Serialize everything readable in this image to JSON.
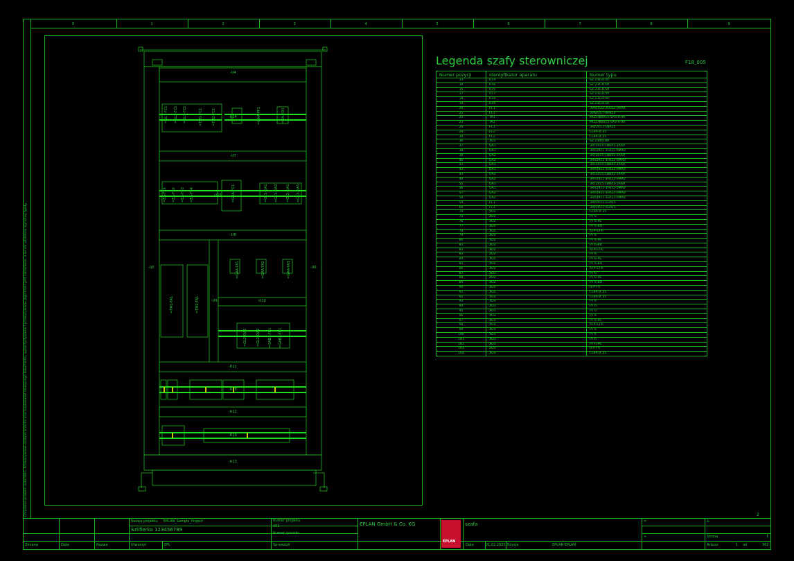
{
  "columns": [
    "0",
    "1",
    "2",
    "3",
    "4",
    "5",
    "6",
    "7",
    "8",
    "9"
  ],
  "side_note": "Chronione prawem autorskim. Przekazywanie osobom trzecim oraz kopiowanie niniejszego dokumentu, wykorzystywanie i przekazywanie jego treści jest zabronione, o ile nie udzielono wyraźnej zgody.",
  "cabinet": {
    "rails": [
      "-U4",
      "-U7",
      "-U8",
      "-U10",
      "-U11",
      "-U12",
      "-U13",
      "-U5",
      "-U6",
      "-U9",
      "-U14",
      "-U15",
      "-U18",
      "-U19"
    ],
    "u14_devices": [
      "=GL1-FC1",
      "=GL2-FC1",
      "=GL3-FC1",
      "=TM1-FC1",
      "=TM2-FC1",
      "=GAA-PF1",
      "=EA-XD1"
    ],
    "u15_devices": [
      "=EA-FB1",
      "=EA-FB2",
      "=EA-FB3",
      "=EA-FB4",
      "=GAA-FC1",
      "=GL1-QA1",
      "=GL1-QA2",
      "=GL2-QA1",
      "=GL3-QA1"
    ],
    "transformers": [
      "=TM1-TA1",
      "=TM2-TA1"
    ],
    "ta_devices": [
      "=GAA-TA1",
      "=GAA-TA2",
      "=GAA-TA3"
    ],
    "u10_devices": [
      "=GL2-QA1",
      "=GL2-QA2",
      "=GAB1-FC1",
      "=GAB2-FC1"
    ]
  },
  "legend": {
    "title": "Legenda szafy sterowniczej",
    "code": "F18_005",
    "headers": [
      "Numer pozycji",
      "Identyfikator aparatu",
      "Numer typu"
    ],
    "rows": [
      [
        "13",
        "U14",
        "SZ.2313150"
      ],
      [
        "14",
        "U16",
        "SZ.2313150"
      ],
      [
        "15",
        "U15",
        "SZ.2313150"
      ],
      [
        "17",
        "U17",
        "SZ.2313150"
      ],
      [
        "18",
        "U18",
        "SZ.2313150"
      ],
      [
        "19",
        "U19",
        "SZ.2313150"
      ],
      [
        "20",
        "FC1",
        "3VA1032-2ED32-0AA0"
      ],
      [
        "21",
        "FC1",
        "3VA9157-0HK25"
      ],
      [
        "22",
        "TA1",
        "MCD780015-SA3-4-00"
      ],
      [
        "23",
        "TA1",
        "MCD780015-SA3-4-00"
      ],
      [
        "24",
        "FC1",
        "3RV2011-1BA25"
      ],
      [
        "29",
        "FC2",
        "CLIPFIX 35"
      ],
      [
        "34",
        "FC2",
        "CLIPFIX 35"
      ],
      [
        "36",
        "XD1",
        "SZ.2306100"
      ],
      [
        "37",
        "QA1",
        "3RT2015-1BB41-1AA0"
      ],
      [
        "38",
        "QA1",
        "3RH2911-1FA22-0MA0"
      ],
      [
        "39",
        "QA2",
        "3RT2015-1BB41-1AA0"
      ],
      [
        "40",
        "QA2",
        "3RH2911-1FA22-0MA0"
      ],
      [
        "41",
        "QA1",
        "3RT2015-1BB41-1AA0"
      ],
      [
        "42",
        "QA1",
        "3RH2911-1FA22-0MA0"
      ],
      [
        "43",
        "QA2",
        "3RT2015-1BB41-1AA0"
      ],
      [
        "44",
        "QA2",
        "3RH2911-1FA22-0MA0"
      ],
      [
        "55",
        "QA1",
        "3RT2015-1BB41-1AA0"
      ],
      [
        "56",
        "QA1",
        "3RH2911-1FA22-0MA0"
      ],
      [
        "57",
        "QA2",
        "3RH2911-1FA22-0MA0"
      ],
      [
        "58",
        "QA2",
        "3RH2911-1FA22-0MA0"
      ],
      [
        "59",
        "FC1",
        "3RV2011-1GA15"
      ],
      [
        "60",
        "FC1",
        "3RV2011-1GA15"
      ],
      [
        "74",
        "XD2",
        "CLIPFIX 35"
      ],
      [
        "75",
        "XD2",
        "PT 6"
      ],
      [
        "76",
        "XD2",
        "PT 6-PE"
      ],
      [
        "77",
        "XD2",
        "PT 6-BU"
      ],
      [
        "78",
        "XD2",
        "ATP-ST-6"
      ],
      [
        "79",
        "XD2",
        "PT 6"
      ],
      [
        "80",
        "XD2",
        "PT 6-PE"
      ],
      [
        "81",
        "XD2",
        "PT 6-BU"
      ],
      [
        "82",
        "XD2",
        "ATP-ST-6"
      ],
      [
        "83",
        "XD2",
        "PT 6"
      ],
      [
        "84",
        "XD2",
        "PT 6-PE"
      ],
      [
        "85",
        "XD2",
        "PT 6-BU"
      ],
      [
        "86",
        "XD2",
        "ATP-ST-6"
      ],
      [
        "87",
        "XD2",
        "PT 6"
      ],
      [
        "88",
        "XD2",
        "PT 6-PE"
      ],
      [
        "89",
        "XD2",
        "PT 6-BU"
      ],
      [
        "90",
        "XD2",
        "D-PT 6"
      ],
      [
        "91",
        "XD2",
        "CLIPFIX 35"
      ],
      [
        "92",
        "XD3",
        "CLIPFIX 35"
      ],
      [
        "93",
        "XD3",
        "PT 6"
      ],
      [
        "94",
        "XD3",
        "PT 6"
      ],
      [
        "95",
        "XD3",
        "PT 6"
      ],
      [
        "96",
        "XD3",
        "PT 6"
      ],
      [
        "97",
        "XD3",
        "PT 6-PE"
      ],
      [
        "98",
        "XD3",
        "ATP-ST-6"
      ],
      [
        "99",
        "XD3",
        "PT 6"
      ],
      [
        "100",
        "XD3",
        "PT 6"
      ],
      [
        "101",
        "XD3",
        "PT 6"
      ],
      [
        "102",
        "XD3",
        "PT 6-PE"
      ],
      [
        "103",
        "XD3",
        "D-PT 6"
      ],
      [
        "104",
        "XD3",
        "CLIPFIX 35"
      ]
    ]
  },
  "page_number": "2",
  "title_block": {
    "project_label": "Nazwa projektu",
    "project_value": "EPLAN_Sample_Project",
    "drawing_title": "Szlifierka 123456789",
    "project_no_label": "Numer projektu",
    "project_no_value": "001",
    "drawing_no_label": "Numer rysunku",
    "company": "EPLAN GmbH & Co. KG",
    "subject": "szafa",
    "logo_text": "EPLAN",
    "eq": "=",
    "amp": "&",
    "plus": "+",
    "strona_label": "Strona",
    "strona_value": "1",
    "arkusz_label": "Arkusz",
    "arkusz_value": "1",
    "od_label": "od",
    "od_value": "362",
    "zmiana": "Zmiana",
    "data": "Data",
    "nazwa": "Nazwa",
    "utworzyl": "Utworzył",
    "utworzyl_value": "EPL",
    "sprawdzil": "Sprawdził",
    "data_label": "Data",
    "data_value": "21.02.2025",
    "edycja": "Edycja",
    "edited_by": "EPLAN EPLAN"
  }
}
